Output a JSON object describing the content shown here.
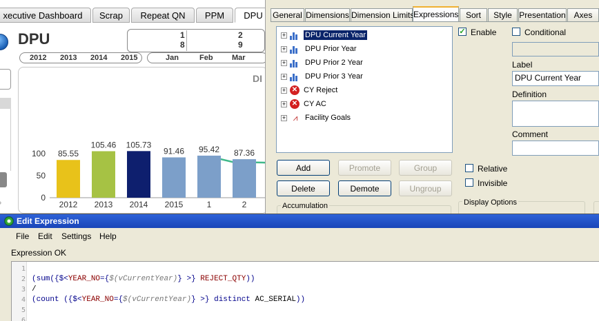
{
  "dashboard": {
    "sheet_tabs": [
      "xecutive Dashboard",
      "Scrap",
      "Repeat QN",
      "PPM",
      "DPU"
    ],
    "active_tab": "DPU",
    "title": "DPU",
    "month_numbers_top": [
      "1",
      "2"
    ],
    "month_numbers_bottom": [
      "8",
      "9"
    ],
    "years": [
      "2012",
      "2013",
      "2014",
      "2015"
    ],
    "months": [
      "Jan",
      "Feb",
      "Mar"
    ],
    "chart_title_fragment": "DI"
  },
  "chart_data": {
    "type": "bar",
    "title": "",
    "categories": [
      "2012",
      "2013",
      "2014",
      "2015",
      "1",
      "2"
    ],
    "values": [
      85.55,
      105.46,
      105.73,
      91.46,
      95.42,
      87.36
    ],
    "value_labels": [
      "85.55",
      "105.46",
      "105.73",
      "91.46",
      "95.42",
      "87.36"
    ],
    "ylim": [
      0,
      150
    ],
    "yticks": [
      0,
      50,
      100
    ],
    "bar_colors": [
      "#e8c21a",
      "#a6c244",
      "#0e1f6e",
      "#7c9fc9",
      "#7c9fc9",
      "#7c9fc9"
    ],
    "goal_line_color": "#3fb98a"
  },
  "properties": {
    "tabs": [
      "General",
      "Dimensions",
      "Dimension Limits",
      "Expressions",
      "Sort",
      "Style",
      "Presentation",
      "Axes"
    ],
    "active_tab": "Expressions",
    "expressions": [
      {
        "label": "DPU Current Year",
        "icon": "bar-chart-icon",
        "selected": true
      },
      {
        "label": "DPU Prior Year",
        "icon": "bar-chart-icon",
        "selected": false
      },
      {
        "label": "DPU Prior 2 Year",
        "icon": "bar-chart-icon",
        "selected": false
      },
      {
        "label": "DPU Prior 3 Year",
        "icon": "bar-chart-icon",
        "selected": false
      },
      {
        "label": "CY Reject",
        "icon": "error-icon",
        "selected": false
      },
      {
        "label": "CY AC",
        "icon": "error-icon",
        "selected": false
      },
      {
        "label": "Facility Goals",
        "icon": "line-chart-icon",
        "selected": false
      }
    ],
    "buttons": {
      "add": "Add",
      "promote": "Promote",
      "group": "Group",
      "delete": "Delete",
      "demote": "Demote",
      "ungroup": "Ungroup"
    },
    "enable_label": "Enable",
    "enable_checked": true,
    "conditional_label": "Conditional",
    "label_caption": "Label",
    "label_value": "DPU Current Year",
    "definition_caption": "Definition",
    "comment_caption": "Comment",
    "relative_label": "Relative",
    "invisible_label": "Invisible",
    "accumulation_caption": "Accumulation",
    "display_options_caption": "Display Options"
  },
  "edit_expression": {
    "window_title": "Edit Expression",
    "menu": [
      "File",
      "Edit",
      "Settings",
      "Help"
    ],
    "status": "Expression OK",
    "line_numbers": [
      "1",
      "2",
      "3",
      "4",
      "5",
      "6"
    ],
    "code": {
      "line2": {
        "a": "(sum({$<",
        "b": "YEAR_NO",
        "c": "={",
        "d": "$(vCurrentYear)",
        "e": "} >} ",
        "f": "REJECT_QTY",
        "g": "))"
      },
      "line3": "/",
      "line4": {
        "a": "(count ({$<",
        "b": "YEAR_NO",
        "c": "={",
        "d": "$(vCurrentYear)",
        "e": "} >} ",
        "f": "distinct",
        "g": " AC_SERIAL",
        "h": "))"
      }
    }
  }
}
